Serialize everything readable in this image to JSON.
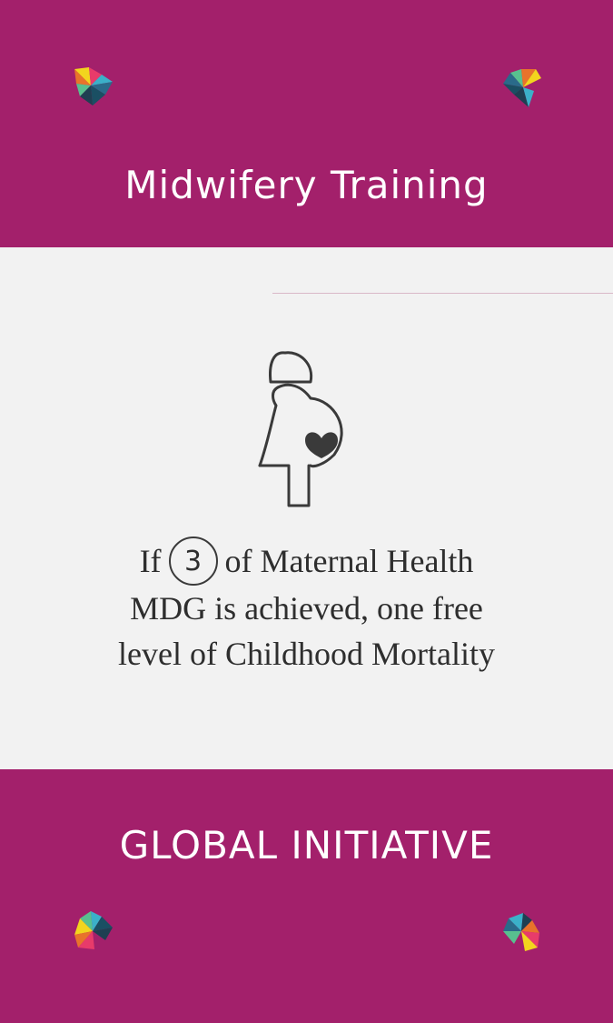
{
  "card": {
    "title": "Midwifery Training",
    "body": {
      "line1_prefix": "If",
      "circled_number": "3",
      "line1_suffix": "of  Maternal Health",
      "line2": "MDG is achieved, one free",
      "line3": "level of Childhood Mortality"
    },
    "footer": "GLOBAL INITIATIVE"
  },
  "colors": {
    "band": "#a3206b",
    "panel": "#f2f2f2",
    "ink": "#2e2e2e"
  },
  "icons": {
    "corner": "pinwheel-logo-icon",
    "center": "pregnant-woman-heart-icon"
  }
}
